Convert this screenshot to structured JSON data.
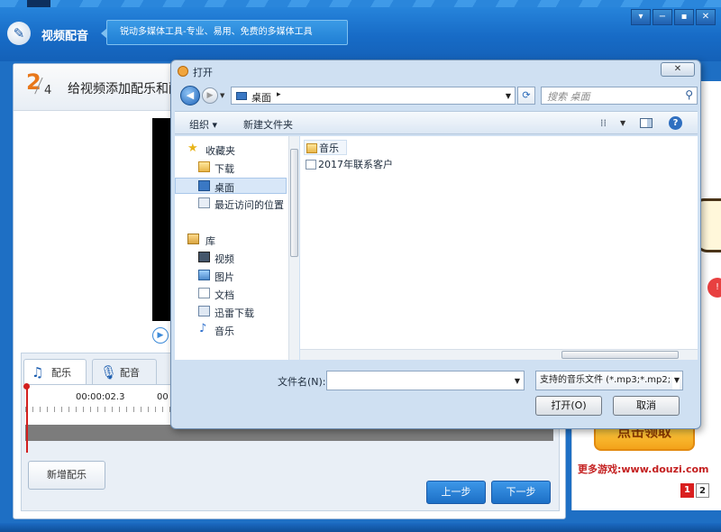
{
  "app": {
    "title": "视频配音",
    "slogan": "锐动多媒体工具-专业、易用、免费的多媒体工具",
    "window_buttons": [
      "▾",
      "−",
      "▪",
      "✕"
    ]
  },
  "step": {
    "number": "2",
    "total": "4",
    "title": "给视频添加配乐和配音"
  },
  "tabs": [
    {
      "label": "配乐",
      "icon": "music-note-icon"
    },
    {
      "label": "配音",
      "icon": "microphone-icon"
    }
  ],
  "timeline": {
    "time_labels": [
      "00:00:02.3",
      "00"
    ]
  },
  "buttons": {
    "add_music": "新增配乐",
    "prev": "上一步",
    "next": "下一步"
  },
  "ad": {
    "banner_text": "点击领取",
    "link_text": "更多游戏:www.douzi.com",
    "pages": [
      "1",
      "2"
    ]
  },
  "dialog": {
    "title": "打开",
    "close_symbol": "✕",
    "address": {
      "location": "桌面",
      "separator": "▸"
    },
    "search_placeholder": "搜索 桌面",
    "commands": {
      "organize": "组织 ▾",
      "new_folder": "新建文件夹"
    },
    "nav_items": [
      {
        "label": "收藏夹",
        "icon": "star-icon"
      },
      {
        "label": "下载",
        "icon": "folder-icon"
      },
      {
        "label": "桌面",
        "icon": "desktop-icon",
        "selected": true
      },
      {
        "label": "最近访问的位置",
        "icon": "recent-places-icon"
      },
      {
        "label": "库",
        "icon": "library-icon"
      },
      {
        "label": "视频",
        "icon": "video-library-icon"
      },
      {
        "label": "图片",
        "icon": "picture-library-icon"
      },
      {
        "label": "文档",
        "icon": "document-library-icon"
      },
      {
        "label": "迅雷下载",
        "icon": "download-folder-icon"
      },
      {
        "label": "音乐",
        "icon": "music-library-icon"
      }
    ],
    "files": [
      {
        "name": "音乐",
        "icon": "folder-icon"
      },
      {
        "name": "2017年联系客户",
        "icon": "shortcut-icon"
      }
    ],
    "filename_label": "文件名(N):",
    "filename_value": "",
    "filter": "支持的音乐文件 (*.mp3;*.mp2;",
    "open_button": "打开(O)",
    "cancel_button": "取消"
  },
  "colors": {
    "header_blue": "#176bc6",
    "accent_orange": "#e8771a",
    "button_blue": "#1c6fc6",
    "playhead_red": "#d21f1f"
  }
}
